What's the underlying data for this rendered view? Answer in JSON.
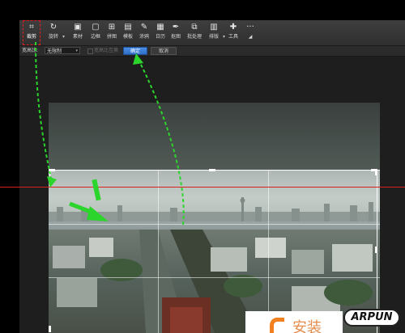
{
  "toolbar": {
    "items": [
      {
        "id": "crop",
        "label": "裁剪",
        "icon": "crop-icon"
      },
      {
        "id": "rotate",
        "label": "旋转",
        "icon": "rotate-icon"
      },
      {
        "id": "material",
        "label": "素材",
        "icon": "material-icon"
      },
      {
        "id": "border",
        "label": "边框",
        "icon": "border-icon"
      },
      {
        "id": "puzzle",
        "label": "拼图",
        "icon": "puzzle-icon"
      },
      {
        "id": "template",
        "label": "模板",
        "icon": "template-icon"
      },
      {
        "id": "graffiti",
        "label": "涂鸦",
        "icon": "brush-icon"
      },
      {
        "id": "calendar",
        "label": "日历",
        "icon": "calendar-icon"
      },
      {
        "id": "eyedrop",
        "label": "抠图",
        "icon": "eyedropper-icon"
      },
      {
        "id": "batch",
        "label": "批处理",
        "icon": "batch-icon"
      },
      {
        "id": "layout",
        "label": "排版",
        "icon": "layout-icon"
      },
      {
        "id": "tools",
        "label": "工具",
        "icon": "wrench-icon"
      }
    ],
    "more_label": "···"
  },
  "crop_options": {
    "ratio_label": "宽高比:",
    "ratio_value": "无限制",
    "rotate_checkbox_label": "宽高比互换",
    "ok_label": "确定",
    "cancel_label": "取消"
  },
  "watermark": {
    "site_text": "ARPUN",
    "logo_glyphs": "安装"
  },
  "colors": {
    "accent": "#2f6fc8",
    "arrow": "#2bd52b",
    "guide_line": "#d82020",
    "highlight": "#e02020"
  }
}
